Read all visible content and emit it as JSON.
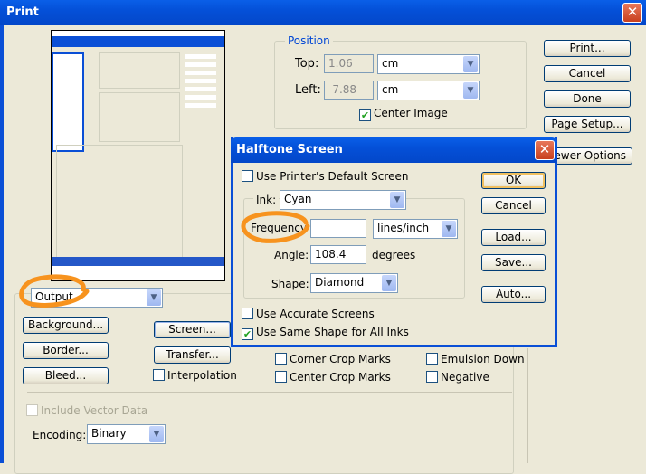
{
  "window": {
    "title": "Print",
    "close": "✕"
  },
  "position": {
    "legend": "Position",
    "top_label": "Top:",
    "top_value": "1.06",
    "top_unit": "cm",
    "left_label": "Left:",
    "left_value": "-7.88",
    "left_unit": "cm",
    "center_image": "Center Image"
  },
  "buttons": {
    "print": "Print...",
    "cancel": "Cancel",
    "done": "Done",
    "page_setup": "Page Setup...",
    "fewer_options": "Fewer Options"
  },
  "output": {
    "selected": "Output",
    "background": "Background...",
    "border": "Border...",
    "bleed": "Bleed...",
    "screen": "Screen...",
    "transfer": "Transfer...",
    "interpolation": "Interpolation",
    "corner_crop": "Corner Crop Marks",
    "center_crop": "Center Crop Marks",
    "emulsion_down": "Emulsion Down",
    "negative": "Negative",
    "include_vector": "Include Vector Data",
    "encoding_label": "Encoding:",
    "encoding_value": "Binary"
  },
  "halftone": {
    "title": "Halftone Screen",
    "close": "✕",
    "use_printer_default": "Use Printer's Default Screen",
    "ink_label": "Ink:",
    "ink_value": "Cyan",
    "frequency_label": "Frequency",
    "frequency_value": "",
    "frequency_unit": "lines/inch",
    "angle_label": "Angle:",
    "angle_value": "108.4",
    "angle_unit": "degrees",
    "shape_label": "Shape:",
    "shape_value": "Diamond",
    "use_accurate": "Use Accurate Screens",
    "use_same_shape": "Use Same Shape for All Inks",
    "check": "✔",
    "ok": "OK",
    "cancel": "Cancel",
    "load": "Load...",
    "save": "Save...",
    "auto": "Auto..."
  },
  "colors": {
    "annotation": "#f7931e",
    "titlebar": "#0450d8"
  }
}
